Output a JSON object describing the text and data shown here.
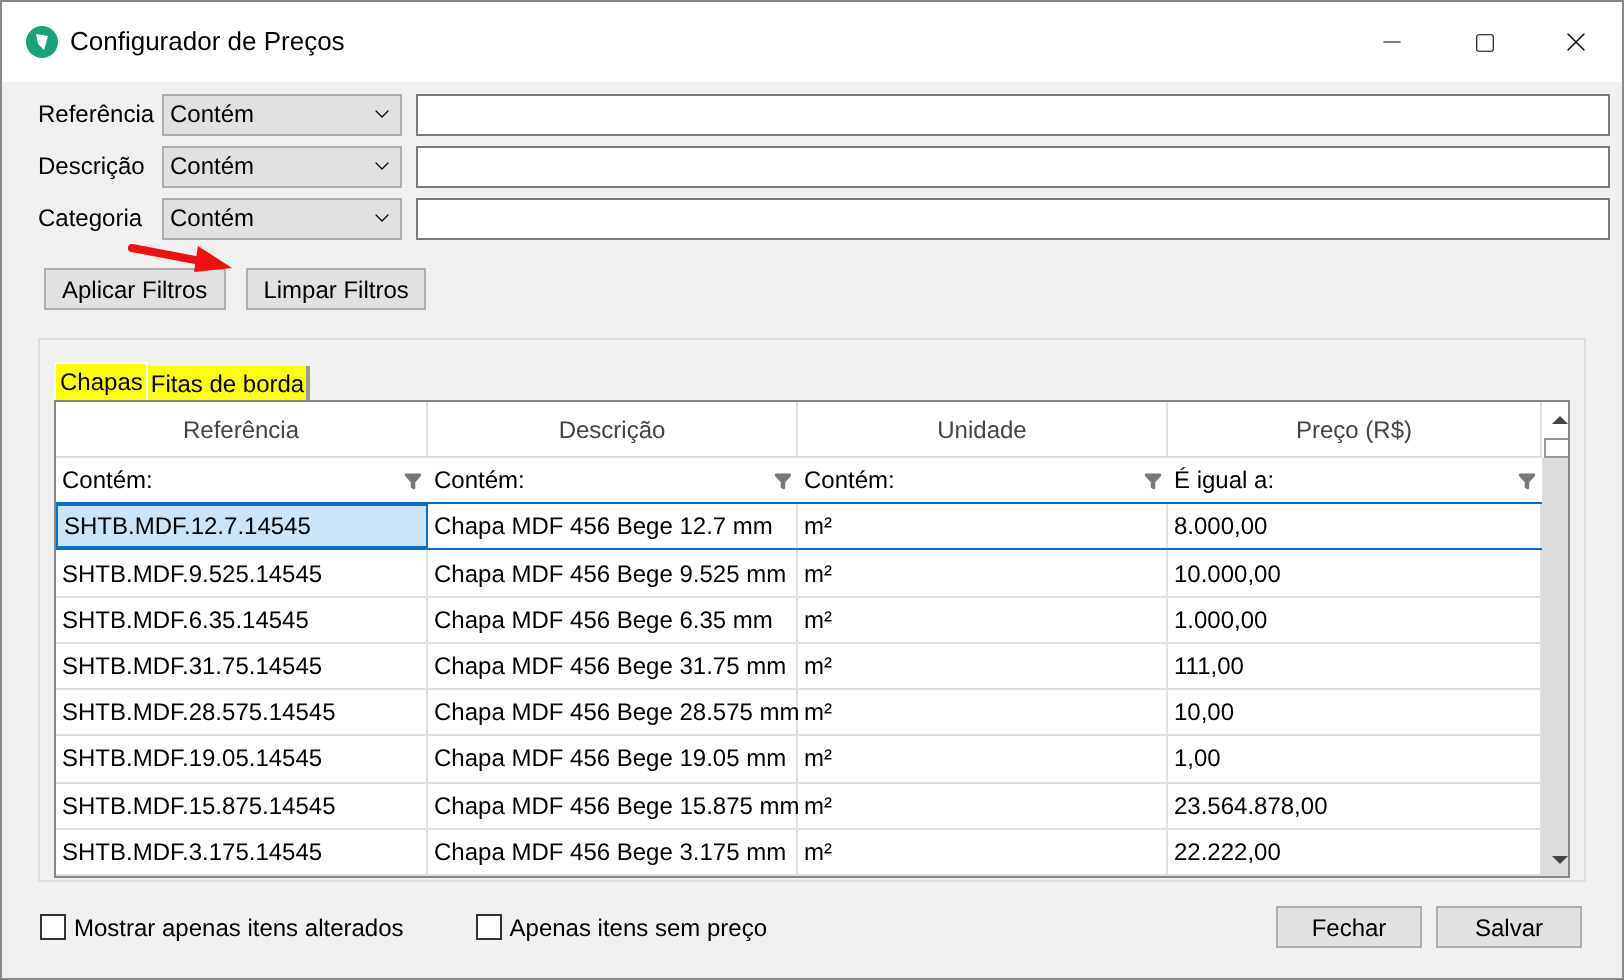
{
  "window": {
    "title": "Configurador de Preços"
  },
  "filters": [
    {
      "label": "Referência",
      "operator": "Contém"
    },
    {
      "label": "Descrição",
      "operator": "Contém"
    },
    {
      "label": "Categoria",
      "operator": "Contém"
    }
  ],
  "filter_buttons": [
    "Aplicar Filtros",
    "Limpar Filtros"
  ],
  "tabs": [
    {
      "label": "Chapas",
      "selected": true
    },
    {
      "label": "Fitas de borda",
      "selected": false
    }
  ],
  "table": {
    "columns": [
      {
        "header": "Referência",
        "filter": "Contém:"
      },
      {
        "header": "Descrição",
        "filter": "Contém:"
      },
      {
        "header": "Unidade",
        "filter": "Contém:"
      },
      {
        "header": "Preço (R$)",
        "filter": "É igual a:"
      }
    ],
    "rows": [
      {
        "cells": [
          "SHTB.MDF.12.7.14545",
          "Chapa MDF 456 Bege 12.7 mm",
          "m²",
          "8.000,00"
        ],
        "selected": true
      },
      {
        "cells": [
          "SHTB.MDF.9.525.14545",
          "Chapa MDF 456 Bege 9.525 mm",
          "m²",
          "10.000,00"
        ],
        "selected": false
      },
      {
        "cells": [
          "SHTB.MDF.6.35.14545",
          "Chapa MDF 456 Bege 6.35 mm",
          "m²",
          "1.000,00"
        ],
        "selected": false
      },
      {
        "cells": [
          "SHTB.MDF.31.75.14545",
          "Chapa MDF 456 Bege 31.75 mm",
          "m²",
          "111,00"
        ],
        "selected": false
      },
      {
        "cells": [
          "SHTB.MDF.28.575.14545",
          "Chapa MDF 456 Bege 28.575 mm",
          "m²",
          "10,00"
        ],
        "selected": false
      },
      {
        "cells": [
          "SHTB.MDF.19.05.14545",
          "Chapa MDF 456 Bege 19.05 mm",
          "m²",
          "1,00"
        ],
        "selected": false
      },
      {
        "cells": [
          "SHTB.MDF.15.875.14545",
          "Chapa MDF 456 Bege 15.875 mm",
          "m²",
          "23.564.878,00"
        ],
        "selected": false
      },
      {
        "cells": [
          "SHTB.MDF.3.175.14545",
          "Chapa MDF 456 Bege 3.175 mm",
          "m²",
          "22.222,00"
        ],
        "selected": false
      }
    ]
  },
  "options": [
    {
      "label": "Mostrar apenas itens alterados",
      "checked": false
    },
    {
      "label": "Apenas itens sem preço",
      "checked": false
    }
  ],
  "buttons": [
    "Fechar",
    "Salvar"
  ]
}
